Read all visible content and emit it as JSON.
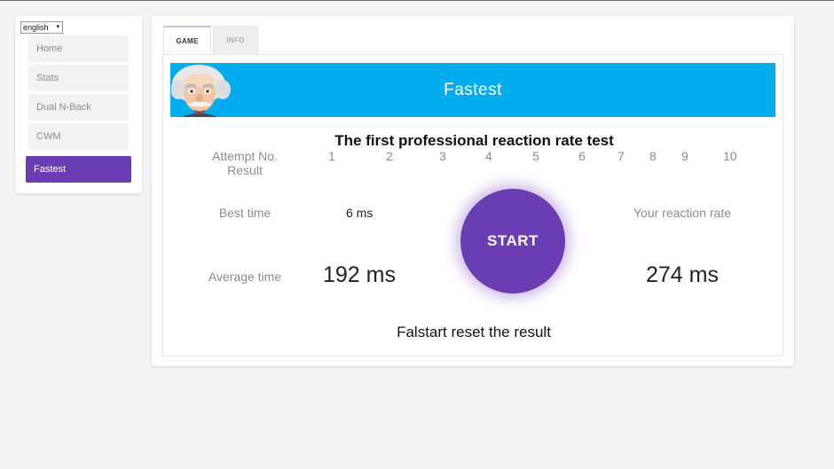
{
  "language": {
    "selected": "english"
  },
  "sidebar": {
    "items": [
      {
        "label": "Home"
      },
      {
        "label": "Stats"
      },
      {
        "label": "Dual N-Back"
      },
      {
        "label": "CWM"
      },
      {
        "label": "Fastest"
      }
    ]
  },
  "tabs": [
    {
      "label": "GAME"
    },
    {
      "label": "INFO"
    }
  ],
  "game": {
    "banner_title": "Fastest",
    "headline": "The first professional reaction rate test",
    "attempt_label": "Attempt No.",
    "result_label": "Result",
    "attempt_numbers": [
      "1",
      "2",
      "3",
      "4",
      "5",
      "6",
      "7",
      "8",
      "9",
      "10"
    ],
    "best_time_label": "Best time",
    "best_time_value": "6 ms",
    "average_time_label": "Average time",
    "average_time_value": "192 ms",
    "start_label": "START",
    "reaction_rate_label": "Your reaction rate",
    "reaction_rate_value": "274 ms",
    "footer": "Falstart reset the result"
  },
  "colors": {
    "accent": "#6a3db3",
    "banner": "#03aced"
  }
}
